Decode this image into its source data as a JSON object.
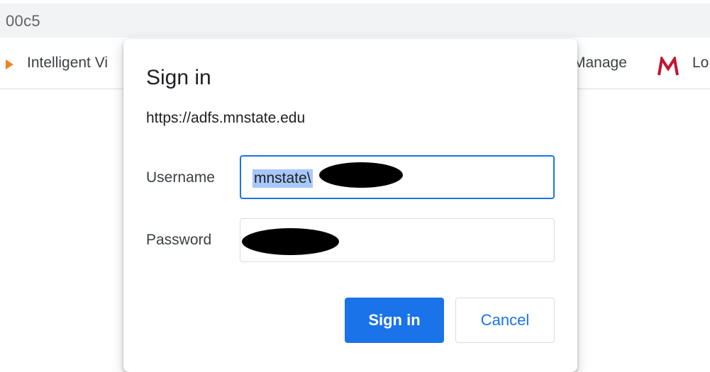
{
  "browser": {
    "address_text": "00c5",
    "bookmarks": [
      {
        "label": "Intelligent Vi",
        "icon": "play-icon"
      },
      {
        "label": "Manage",
        "icon": null
      },
      {
        "label": "Lo",
        "icon": "m-logo-icon"
      }
    ]
  },
  "dialog": {
    "title": "Sign in",
    "origin": "https://adfs.mnstate.edu",
    "username_label": "Username",
    "username_value": "mnstate\\",
    "password_label": "Password",
    "signin_label": "Sign in",
    "cancel_label": "Cancel"
  },
  "colors": {
    "accent": "#1a73e8",
    "selection": "#a8c7fa",
    "bookmark_play": "#f4811f",
    "m_logo": "#c41230"
  }
}
